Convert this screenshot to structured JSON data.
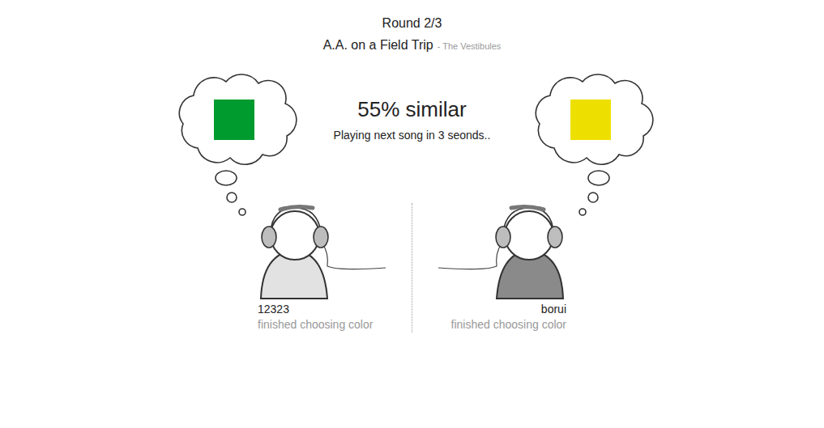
{
  "round": "Round 2/3",
  "song": {
    "title": "A.A. on a Field Trip",
    "artist": "- The Vestibules"
  },
  "result": {
    "similarity": "55% similar",
    "countdown": "Playing next song in 3 seonds.."
  },
  "players": [
    {
      "name": "12323",
      "status": "finished choosing color",
      "color": "#009b2e",
      "shirt_color": "#e2e2e2"
    },
    {
      "name": "borui",
      "status": "finished choosing color",
      "color": "#ede000",
      "shirt_color": "#8a8a8a"
    }
  ]
}
